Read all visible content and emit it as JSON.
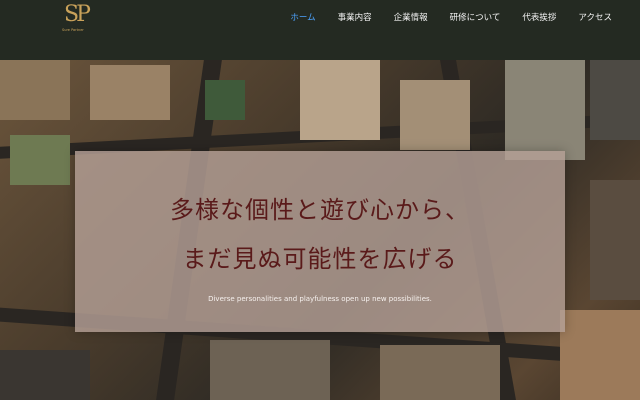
{
  "brand": {
    "monogram": "SP",
    "tagline": "Sure Partner"
  },
  "nav": {
    "items": [
      {
        "label": "ホーム"
      },
      {
        "label": "事業内容"
      },
      {
        "label": "企業情報"
      },
      {
        "label": "研修について"
      },
      {
        "label": "代表挨拶"
      },
      {
        "label": "アクセス"
      }
    ],
    "active_color": "#4da3ff",
    "text_color": "#f2f2f2"
  },
  "hero": {
    "headline_line1": "多様な個性と遊び心から、",
    "headline_line2": "まだ見ぬ可能性を広げる",
    "subtitle": "Diverse personalities and playfulness open up new possibilities.",
    "headline_color": "#5a1a1a"
  },
  "colors": {
    "header_bg": "#242a22",
    "logo_gold": "#c9a25a"
  }
}
